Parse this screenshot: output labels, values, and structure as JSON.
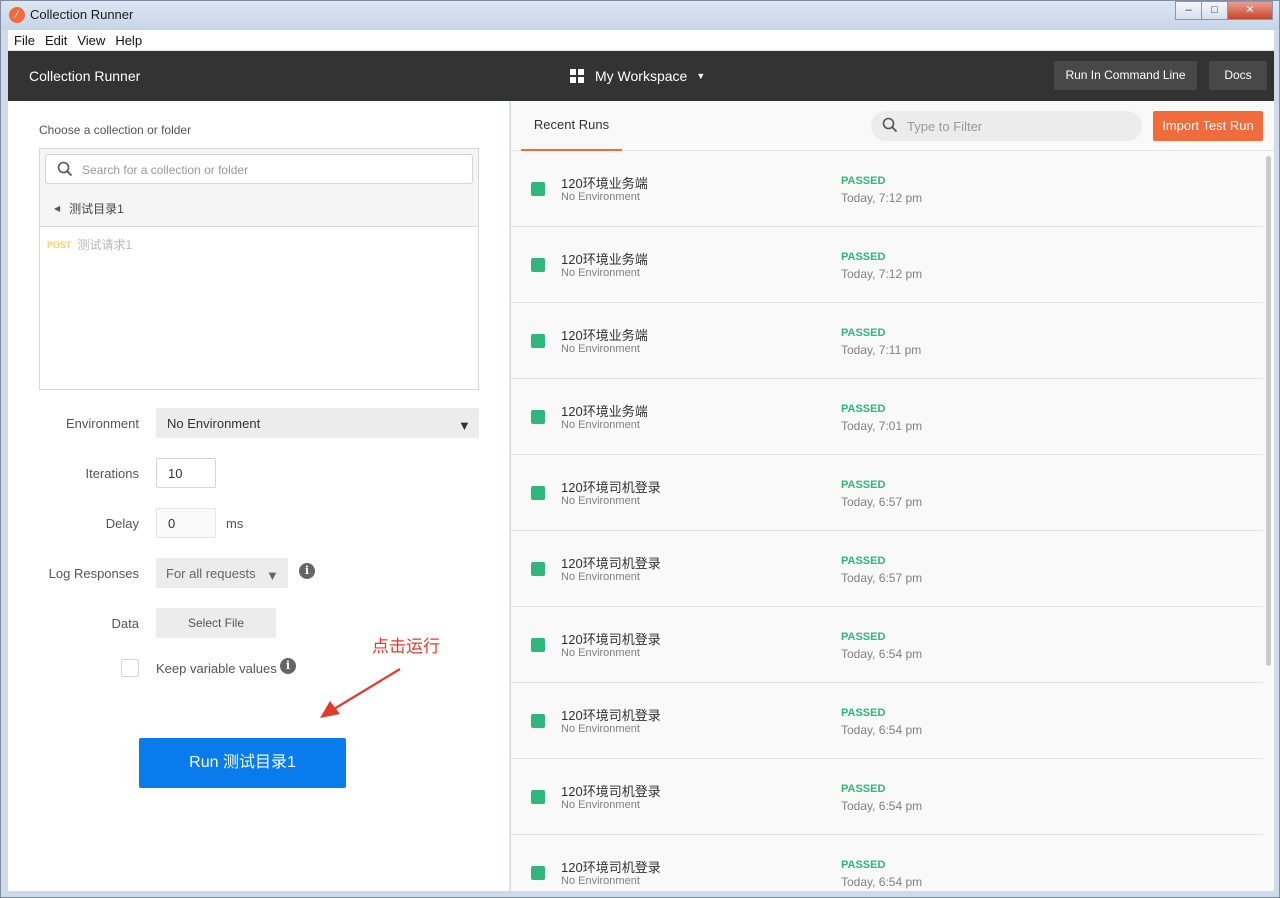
{
  "window": {
    "title": "Collection Runner",
    "controls": {
      "minimize": "‒",
      "maximize": "□",
      "close": "✕"
    }
  },
  "menubar": {
    "items": [
      "File",
      "Edit",
      "View",
      "Help"
    ]
  },
  "header": {
    "title": "Collection Runner",
    "workspace": "My Workspace",
    "cmd_button": "Run In Command Line",
    "docs_button": "Docs"
  },
  "left": {
    "choose_label": "Choose a collection or folder",
    "search_placeholder": "Search for a collection or folder",
    "folder_name": "测试目录1",
    "request": {
      "method": "POST",
      "name": "测试请求1"
    },
    "environment": {
      "label": "Environment",
      "value": "No Environment"
    },
    "iterations": {
      "label": "Iterations",
      "value": "10"
    },
    "delay": {
      "label": "Delay",
      "value": "0",
      "unit": "ms"
    },
    "log": {
      "label": "Log Responses",
      "value": "For all requests"
    },
    "data": {
      "label": "Data",
      "button": "Select File"
    },
    "keep": {
      "label": "Keep variable values",
      "checked": false
    },
    "annotation": "点击运行",
    "run_button": "Run 测试目录1"
  },
  "right": {
    "tab": "Recent Runs",
    "filter_placeholder": "Type to Filter",
    "import_button": "Import Test Run",
    "status_color": "#2eb67d",
    "accent_color": "#f26b3a",
    "runs": [
      {
        "name": "120环境业务端",
        "env": "No Environment",
        "status": "PASSED",
        "time": "Today, 7:12 pm"
      },
      {
        "name": "120环境业务端",
        "env": "No Environment",
        "status": "PASSED",
        "time": "Today, 7:12 pm"
      },
      {
        "name": "120环境业务端",
        "env": "No Environment",
        "status": "PASSED",
        "time": "Today, 7:11 pm"
      },
      {
        "name": "120环境业务端",
        "env": "No Environment",
        "status": "PASSED",
        "time": "Today, 7:01 pm"
      },
      {
        "name": "120环境司机登录",
        "env": "No Environment",
        "status": "PASSED",
        "time": "Today, 6:57 pm"
      },
      {
        "name": "120环境司机登录",
        "env": "No Environment",
        "status": "PASSED",
        "time": "Today, 6:57 pm"
      },
      {
        "name": "120环境司机登录",
        "env": "No Environment",
        "status": "PASSED",
        "time": "Today, 6:54 pm"
      },
      {
        "name": "120环境司机登录",
        "env": "No Environment",
        "status": "PASSED",
        "time": "Today, 6:54 pm"
      },
      {
        "name": "120环境司机登录",
        "env": "No Environment",
        "status": "PASSED",
        "time": "Today, 6:54 pm"
      },
      {
        "name": "120环境司机登录",
        "env": "No Environment",
        "status": "PASSED",
        "time": "Today, 6:54 pm"
      }
    ]
  }
}
